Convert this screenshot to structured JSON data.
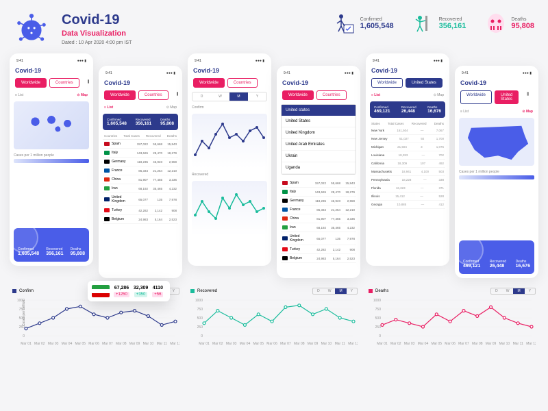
{
  "header": {
    "title": "Covid-19",
    "subtitle": "Data Visualization",
    "dated": "Dated : 10 Apr 2020 4:00 pm IST"
  },
  "global_stats": {
    "confirmed": {
      "label": "Confirmed",
      "value": "1,605,548"
    },
    "recovered": {
      "label": "Recovered",
      "value": "356,161"
    },
    "deaths": {
      "label": "Deaths",
      "value": "95,808"
    }
  },
  "phone": {
    "time": "9:41",
    "title": "Covid-19",
    "worldwide": "Worldwide",
    "countries": "Countries",
    "united_states": "United States",
    "list": "≡ List",
    "map": "⊙ Map",
    "cases_per_million": "Cases per 1 million people",
    "period": {
      "d": "D",
      "w": "W",
      "m": "M",
      "y": "Y"
    }
  },
  "summary": {
    "confirmed": {
      "label": "Confirmed",
      "value": "1,605,548"
    },
    "recovered": {
      "label": "Recovered",
      "value": "356,161"
    },
    "deaths": {
      "label": "Deaths",
      "value": "95,808"
    }
  },
  "us_summary": {
    "confirmed": {
      "label": "Confirmed",
      "value": "469,121"
    },
    "recovered": {
      "label": "Recovered",
      "value": "26,448"
    },
    "deaths": {
      "label": "Deaths",
      "value": "16,676"
    }
  },
  "table_headers": {
    "countries": "Countries",
    "total": "Total Cases",
    "recovered": "Recovered",
    "deaths": "Deaths"
  },
  "countries": [
    {
      "name": "Spain",
      "flag": "#c60b1e",
      "c1": "157,022",
      "c2": "55,668",
      "c3": "15,843"
    },
    {
      "name": "Italy",
      "flag": "#009246",
      "c1": "143,626",
      "c2": "28,470",
      "c3": "18,279"
    },
    {
      "name": "Germany",
      "flag": "#000",
      "c1": "118,235",
      "c2": "46,923",
      "c3": "2,559"
    },
    {
      "name": "France",
      "flag": "#0055a4",
      "c1": "86,334",
      "c2": "21,254",
      "c3": "12,210"
    },
    {
      "name": "China",
      "flag": "#de2910",
      "c1": "81,907",
      "c2": "77,455",
      "c3": "3,336"
    },
    {
      "name": "Iran",
      "flag": "#239f40",
      "c1": "68,192",
      "c2": "35,465",
      "c3": "4,232"
    },
    {
      "name": "United Kingdom",
      "flag": "#012169",
      "c1": "65,077",
      "c2": "135",
      "c3": "7,978"
    },
    {
      "name": "Turkey",
      "flag": "#e30a17",
      "c1": "42,282",
      "c2": "2,142",
      "c3": "908"
    },
    {
      "name": "Belgium",
      "flag": "#000",
      "c1": "24,983",
      "c2": "5,164",
      "c3": "2,523"
    }
  ],
  "dropdown": {
    "selected": "United states",
    "items": [
      "United States",
      "United Kingdom",
      "United Arab Emirates",
      "Ukrain",
      "Uganda"
    ]
  },
  "hover": {
    "cases": {
      "total": "67,286",
      "delta": "+1250"
    },
    "recovered": {
      "total": "32,309",
      "delta": "+350"
    },
    "deaths": {
      "total": "4110",
      "delta": "+56"
    }
  },
  "states_headers": {
    "states": "States",
    "total": "Total Cases",
    "recovered": "Recovered",
    "deaths": "Deaths"
  },
  "states": [
    {
      "name": "New York",
      "c1": "161,504",
      "c2": "—",
      "c3": "7,067"
    },
    {
      "name": "New Jersey",
      "c1": "51,027",
      "c2": "92",
      "c3": "1,700"
    },
    {
      "name": "Michigan",
      "c1": "21,504",
      "c2": "3",
      "c3": "1,076"
    },
    {
      "name": "Louisiana",
      "c1": "18,283",
      "c2": "—",
      "c3": "702"
    },
    {
      "name": "California",
      "c1": "18,309",
      "c2": "107",
      "c3": "492"
    },
    {
      "name": "Massachusetts",
      "c1": "18,941",
      "c2": "4,100",
      "c3": "503"
    },
    {
      "name": "Pennsylvania",
      "c1": "18,228",
      "c2": "—",
      "c3": "338"
    },
    {
      "name": "Florida",
      "c1": "16,323",
      "c2": "—",
      "c3": "371"
    },
    {
      "name": "Illinois",
      "c1": "15,412",
      "c2": "—",
      "c3": "528"
    },
    {
      "name": "Georgia",
      "c1": "10,885",
      "c2": "—",
      "c3": "412"
    }
  ],
  "chart_titles": {
    "confirm": "Confirm",
    "recovered": "Recovered",
    "deaths": "Dearhs"
  },
  "chart_data": [
    {
      "type": "line",
      "title": "Confirm",
      "color": "#2d3a8c",
      "ylim": [
        0,
        1000
      ],
      "ylabel": "Cases per million",
      "x": [
        "Mar 01",
        "Mar 02",
        "Mar 03",
        "Mar 04",
        "Mar 05",
        "Mar 06",
        "Mar 07",
        "Mar 08",
        "Mar 09",
        "Mar 10",
        "Mar 11",
        "Mar 12"
      ],
      "values": [
        200,
        350,
        500,
        750,
        820,
        600,
        500,
        650,
        700,
        550,
        300,
        400
      ]
    },
    {
      "type": "line",
      "title": "Recovered",
      "color": "#1abc9c",
      "ylim": [
        0,
        1000
      ],
      "ylabel": "Cases per million",
      "x": [
        "Mar 01",
        "Mar 02",
        "Mar 03",
        "Mar 04",
        "Mar 05",
        "Mar 06",
        "Mar 07",
        "Mar 08",
        "Mar 09",
        "Mar 10",
        "Mar 11",
        "Mar 12"
      ],
      "values": [
        350,
        700,
        500,
        300,
        600,
        400,
        800,
        850,
        600,
        750,
        500,
        400
      ]
    },
    {
      "type": "line",
      "title": "Deaths",
      "color": "#e91e63",
      "ylim": [
        0,
        1000
      ],
      "ylabel": "Cases per million",
      "x": [
        "Mar 01",
        "Mar 02",
        "Mar 03",
        "Mar 04",
        "Mar 05",
        "Mar 06",
        "Mar 07",
        "Mar 08",
        "Mar 09",
        "Mar 10",
        "Mar 11",
        "Mar 12"
      ],
      "values": [
        300,
        450,
        350,
        250,
        600,
        400,
        700,
        550,
        800,
        500,
        350,
        250
      ]
    }
  ],
  "mini_chart_labels": {
    "confirm": "Confirm",
    "recovered": "Recovered"
  }
}
